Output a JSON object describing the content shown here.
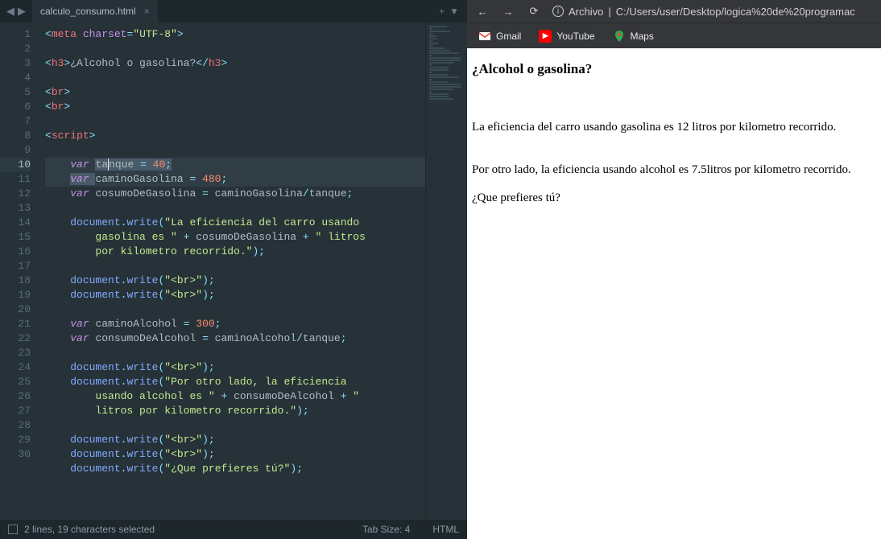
{
  "editor": {
    "tab_name": "calculo_consumo.html",
    "status_selection": "2 lines, 19 characters selected",
    "status_tabsize": "Tab Size: 4",
    "status_lang": "HTML",
    "lines": [
      1,
      2,
      3,
      4,
      5,
      6,
      7,
      8,
      9,
      10,
      11,
      12,
      13,
      14,
      15,
      16,
      17,
      18,
      19,
      20,
      21,
      22,
      23,
      24,
      25,
      26,
      27,
      28,
      29,
      30
    ],
    "code": {
      "l1_tag_open": "<",
      "l1_tag": "meta",
      "l1_attr": " charset",
      "l1_eq": "=",
      "l1_str": "\"UTF-8\"",
      "l1_close": ">",
      "l3_open": "<",
      "l3_h3": "h3",
      "l3_gt": ">",
      "l3_txt": "¿Alcohol o gasolina?",
      "l3_c1": "</",
      "l3_c2": ">",
      "br_open": "<",
      "br": "br",
      "br_close": ">",
      "script_open": "<",
      "script": "script",
      "script_gt": ">",
      "var": "var ",
      "tanque": "tanque",
      "eq": " = ",
      "n40": "40",
      "semi": ";",
      "caminoGasolina": "caminoGasolina",
      "n480": "480",
      "cosumoDeGasolina": "cosumoDeGasolina",
      "slash": "/",
      "document": "document",
      "dot": ".",
      "write": "write",
      "po": "(",
      "pc": ")",
      "s14": "\"La eficiencia del carro usando ",
      "s14b": "gasolina es \"",
      "plus": " + ",
      "s14c": "\" litros ",
      "s14d": "por kilometro recorrido.\"",
      "sbr": "\"<br>\"",
      "caminoAlcohol": "caminoAlcohol",
      "n300": "300",
      "consumoDeAlcohol": "consumoDeAlcohol",
      "s23a": "\"Por otro lado, la eficiencia ",
      "s23b": "usando alcohol es \"",
      "s23c": "\" ",
      "s23d": "litros por kilometro recorrido.\"",
      "s27": "\"¿Que prefieres tú?\""
    }
  },
  "browser": {
    "addr_label": "Archivo",
    "addr_sep": "|",
    "addr_path": "C:/Users/user/Desktop/logica%20de%20programac",
    "bookmarks": {
      "gmail": "Gmail",
      "youtube": "YouTube",
      "maps": "Maps"
    },
    "page": {
      "title": "¿Alcohol o gasolina?",
      "p1": "La eficiencia del carro usando gasolina es 12 litros por kilometro recorrido.",
      "p2": "Por otro lado, la eficiencia usando alcohol es 7.5litros por kilometro recorrido.",
      "p3": "¿Que prefieres tú?"
    }
  }
}
